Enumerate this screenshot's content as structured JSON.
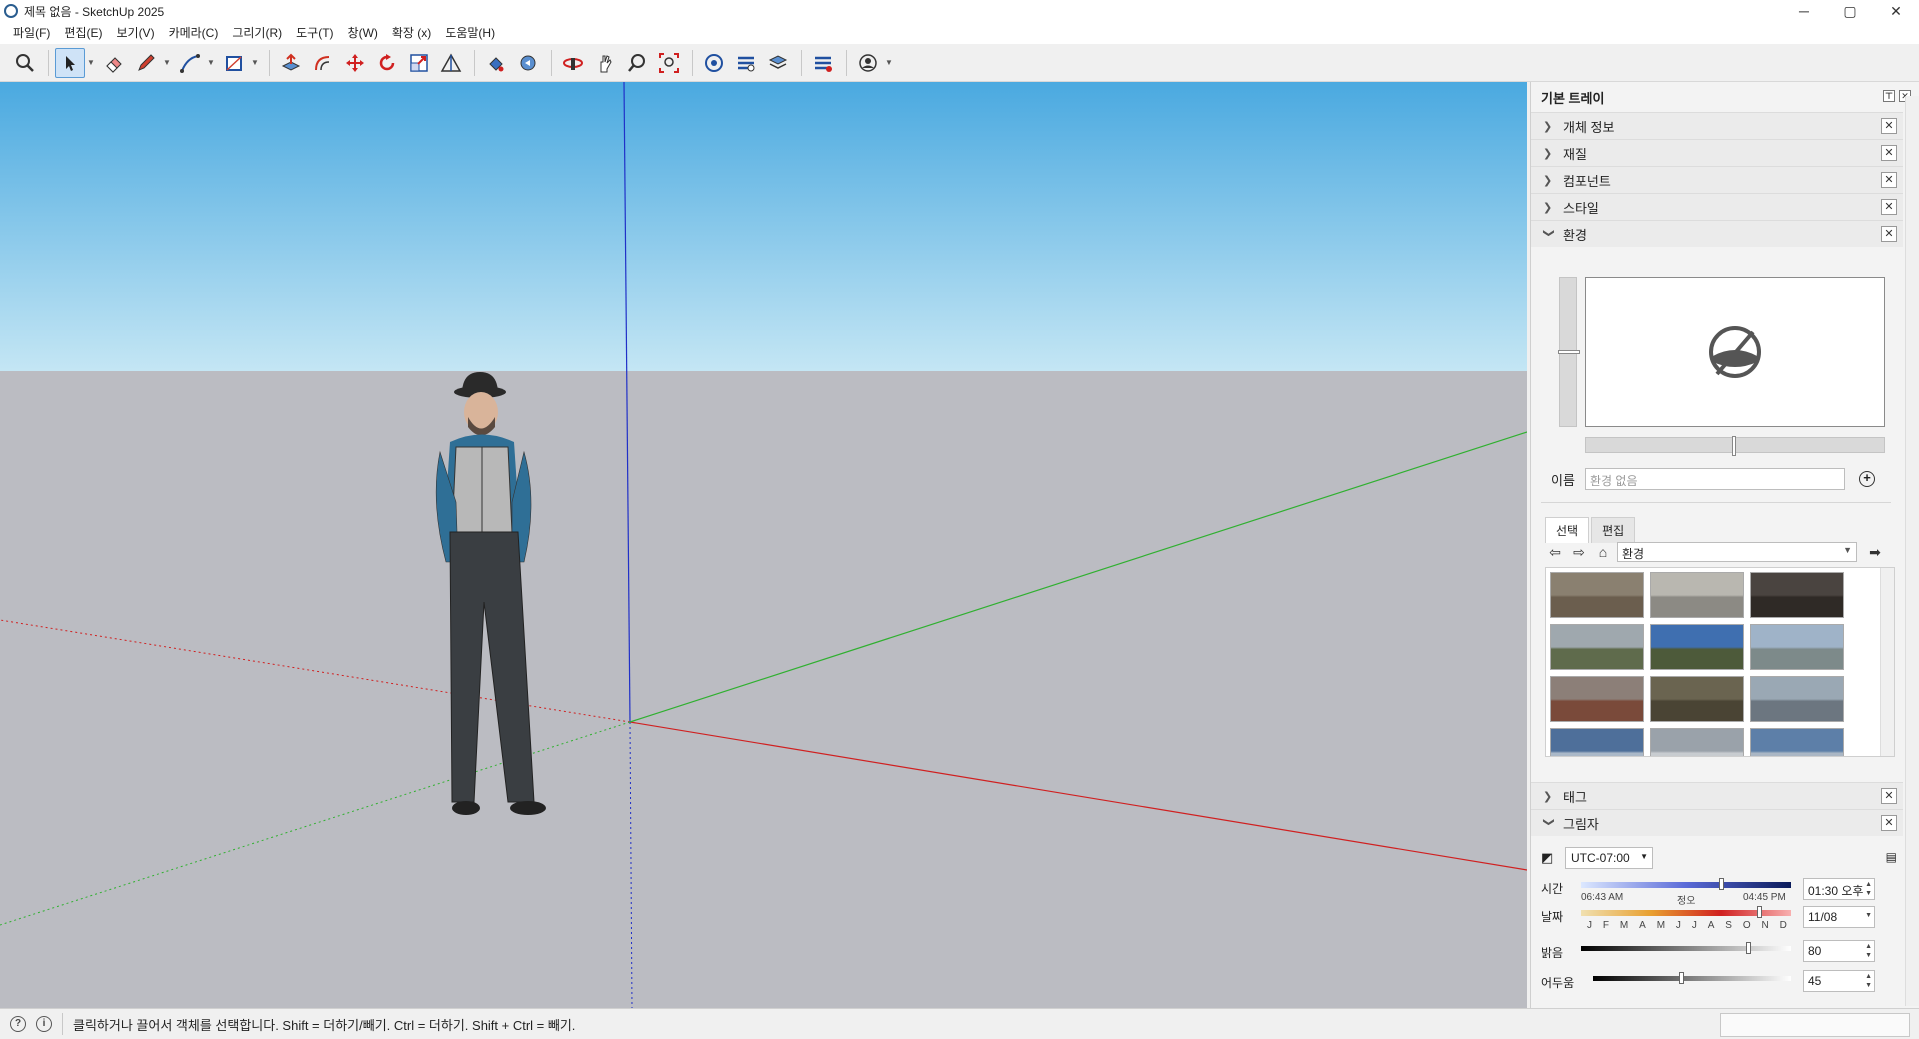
{
  "window": {
    "title": "제목 없음 - SketchUp 2025",
    "minimize": "─",
    "maximize": "▢",
    "close": "✕"
  },
  "menu": [
    "파일(F)",
    "편집(E)",
    "보기(V)",
    "카메라(C)",
    "그리기(R)",
    "도구(T)",
    "창(W)",
    "확장 (x)",
    "도움말(H)"
  ],
  "toolbar": {
    "tools": [
      "search-icon",
      "select-icon",
      "eraser-icon",
      "pencil-icon",
      "line-icon",
      "rectangle-icon",
      "push-pull-icon",
      "offset-icon",
      "move-icon",
      "rotate-icon",
      "scale-icon",
      "tape-measure-icon",
      "paint-icon",
      "follow-me-icon",
      "orbit-icon",
      "pan-icon",
      "zoom-icon",
      "zoom-extents-icon",
      "warehouse-icon",
      "extension-icon",
      "layers-icon",
      "components-icon",
      "account-icon"
    ],
    "active": "select-icon"
  },
  "tray": {
    "title": "기본 트레이",
    "panels": {
      "entity_info": "개체 정보",
      "materials": "재질",
      "components": "컴포넌트",
      "styles": "스타일",
      "environment": "환경",
      "tags": "태그",
      "shadows": "그림자"
    },
    "environment": {
      "name_label": "이름",
      "name_placeholder": "환경 없음",
      "tab_select": "선택",
      "tab_edit": "편집",
      "collection": "환경",
      "thumbnails": [
        {
          "sky": "#8a8070",
          "ground": "#6b5e4e"
        },
        {
          "sky": "#b9b7b0",
          "ground": "#8c8a84"
        },
        {
          "sky": "#4a4440",
          "ground": "#2f2a26"
        },
        {
          "sky": "#9fa8ae",
          "ground": "#5f6b4c"
        },
        {
          "sky": "#3f6fb0",
          "ground": "#4d5a3a"
        },
        {
          "sky": "#9fb3c8",
          "ground": "#7d8a8a"
        },
        {
          "sky": "#8c7f78",
          "ground": "#7a4a3a"
        },
        {
          "sky": "#6a6450",
          "ground": "#4a4434"
        },
        {
          "sky": "#9aa8b4",
          "ground": "#6c7680"
        },
        {
          "sky": "#4e6f9a",
          "ground": "#aab8c8"
        },
        {
          "sky": "#9aa2aa",
          "ground": "#c8ccd0"
        },
        {
          "sky": "#5d7fa8",
          "ground": "#aab6c4"
        }
      ]
    },
    "shadows": {
      "timezone": "UTC-07:00",
      "time_label": "시간",
      "time_start": "06:43 AM",
      "time_noon": "정오",
      "time_end": "04:45 PM",
      "time_value": "01:30 오후",
      "date_label": "날짜",
      "months": [
        "J",
        "F",
        "M",
        "A",
        "M",
        "J",
        "J",
        "A",
        "S",
        "O",
        "N",
        "D"
      ],
      "date_value": "11/08",
      "light_label": "밝음",
      "light_value": "80",
      "dark_label": "어두움",
      "dark_value": "45",
      "time_fraction": 0.67,
      "date_fraction": 0.85,
      "light_fraction": 0.8,
      "dark_fraction": 0.45
    }
  },
  "status": {
    "text": "클릭하거나 끌어서 객체를 선택합니다. Shift = 더하기/빼기. Ctrl = 더하기. Shift + Ctrl = 빼기."
  },
  "colors": {
    "sky_top": "#4aa9e0",
    "sky_bottom": "#c4e6f4",
    "ground": "#bbbcc2",
    "axis_red": "#d02020",
    "axis_green": "#30b030",
    "axis_blue": "#2030c8",
    "accent": "#5a9bd5"
  }
}
